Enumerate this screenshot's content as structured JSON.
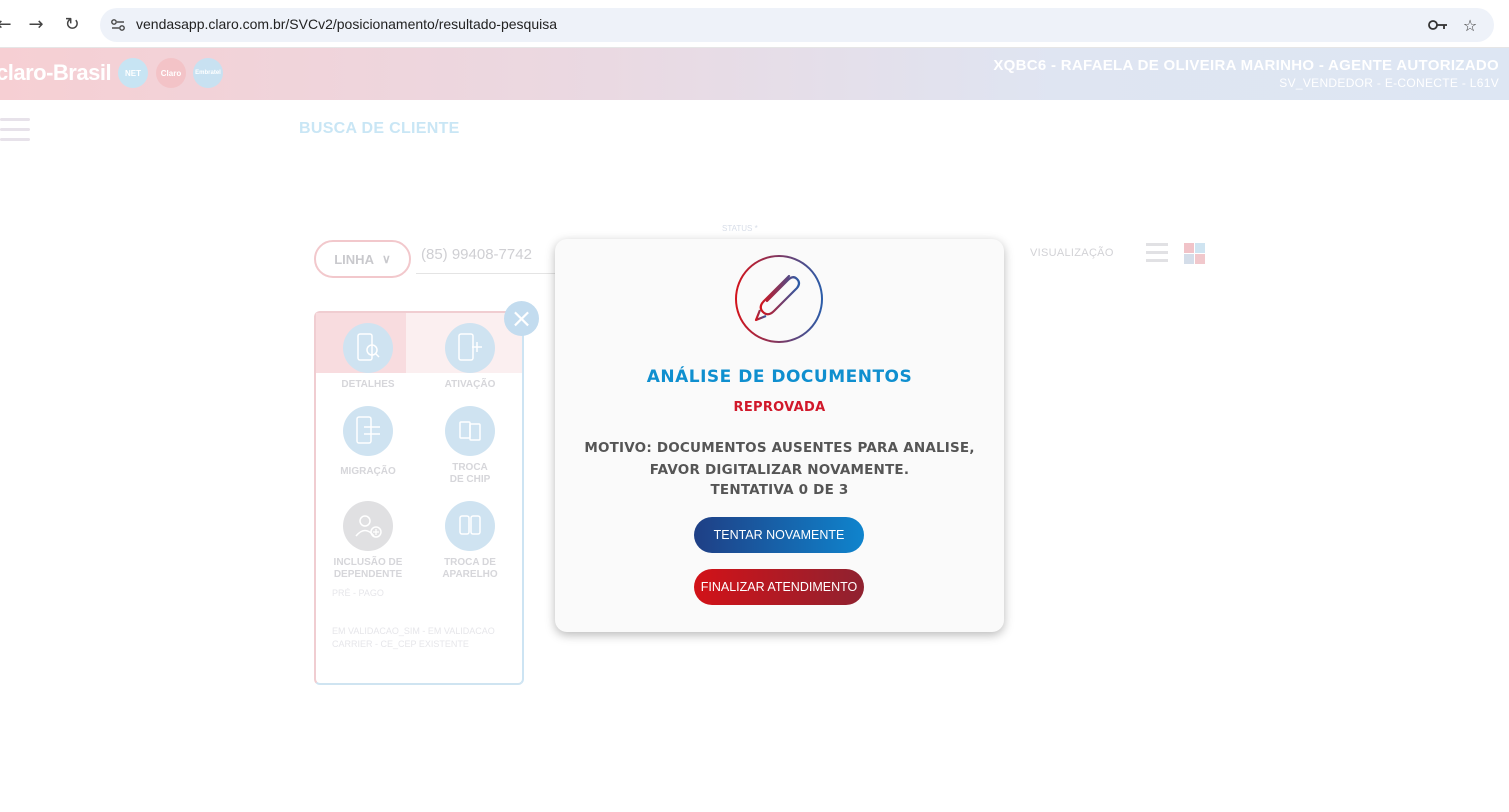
{
  "browser": {
    "url": "vendasapp.claro.com.br/SVCv2/posicionamento/resultado-pesquisa"
  },
  "header": {
    "logo_text": "claro-Brasil",
    "brands": [
      "NET",
      "Claro",
      "Embratel"
    ],
    "user_name": "XQBC6 - RAFAELA DE OLIVEIRA MARINHO - AGENTE AUTORIZADO",
    "user_role": "SV_VENDEDOR - E-CONECTE - L61V"
  },
  "page": {
    "title": "BUSCA DE CLIENTE"
  },
  "search": {
    "type_label": "LINHA",
    "phone_value": "(85) 99408-7742",
    "status_label": "STATUS *",
    "view_label": "VISUALIZAÇÃO"
  },
  "card": {
    "actions": [
      {
        "label": "DETALHES"
      },
      {
        "label": "ATIVAÇÃO"
      },
      {
        "label": "MIGRAÇÃO"
      },
      {
        "label": "TROCA\nDE CHIP"
      },
      {
        "label": "INCLUSÃO DE\nDEPENDENTE"
      },
      {
        "label": "TROCA DE\nAPARELHO"
      }
    ],
    "footer_type": "PRÉ - PAGO",
    "footer_status_line1": "EM VALIDACAO_SIM - EM VALIDACAO",
    "footer_status_line2": "CARRIER - CE_CEP EXISTENTE"
  },
  "modal": {
    "title": "ANÁLISE DE DOCUMENTOS",
    "status": "REPROVADA",
    "reason": "MOTIVO: DOCUMENTOS AUSENTES PARA ANALISE, FAVOR DIGITALIZAR NOVAMENTE.",
    "attempt": "TENTATIVA 0 DE 3",
    "retry_label": "TENTAR NOVAMENTE",
    "finish_label": "FINALIZAR ATENDIMENTO"
  },
  "colors": {
    "accent_blue": "#0f8fcf",
    "status_red": "#d1182a"
  }
}
